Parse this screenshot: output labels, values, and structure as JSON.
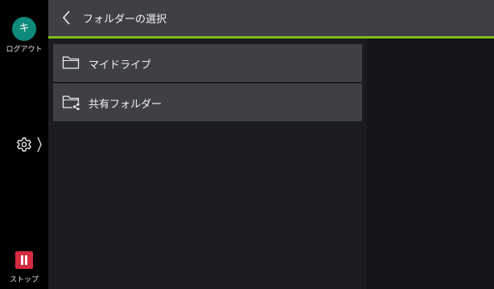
{
  "rail": {
    "avatar_char": "キ",
    "logout_label": "ログアウト",
    "stop_label": "ストップ"
  },
  "header": {
    "title": "フォルダーの選択"
  },
  "list": {
    "items": [
      {
        "label": "マイドライブ",
        "icon": "folder-icon"
      },
      {
        "label": "共有フォルダー",
        "icon": "shared-folder-icon"
      }
    ]
  },
  "colors": {
    "accent_line": "#7cbd1e",
    "avatar": "#0d8a7a",
    "stop": "#d62b3e"
  }
}
